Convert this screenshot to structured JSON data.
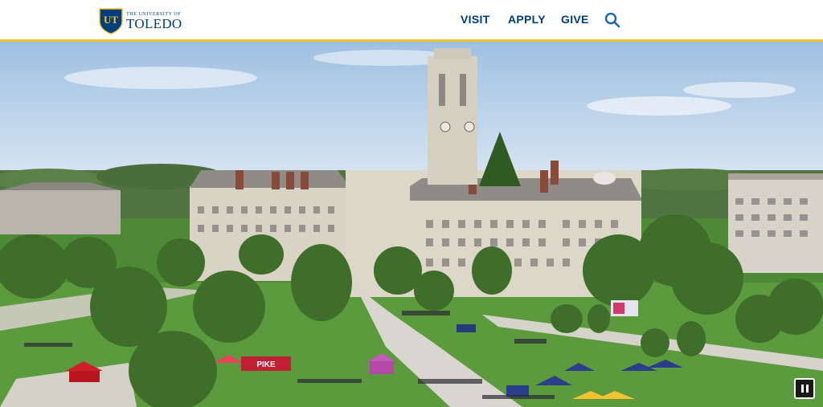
{
  "header": {
    "logo": {
      "monogram": "UT",
      "line1": "THE UNIVERSITY OF",
      "line2": "TOLEDO"
    },
    "nav": [
      {
        "label": "VISIT"
      },
      {
        "label": "APPLY"
      },
      {
        "label": "GIVE"
      }
    ],
    "search_icon": "search-icon",
    "accent_color": "#f2c230",
    "brand_color": "#003e7e"
  },
  "hero": {
    "media": "video",
    "subject": "aerial view of campus with clock tower and festival tents",
    "tent_banner": "PIKE",
    "control": {
      "icon": "pause-icon",
      "state": "playing"
    }
  }
}
